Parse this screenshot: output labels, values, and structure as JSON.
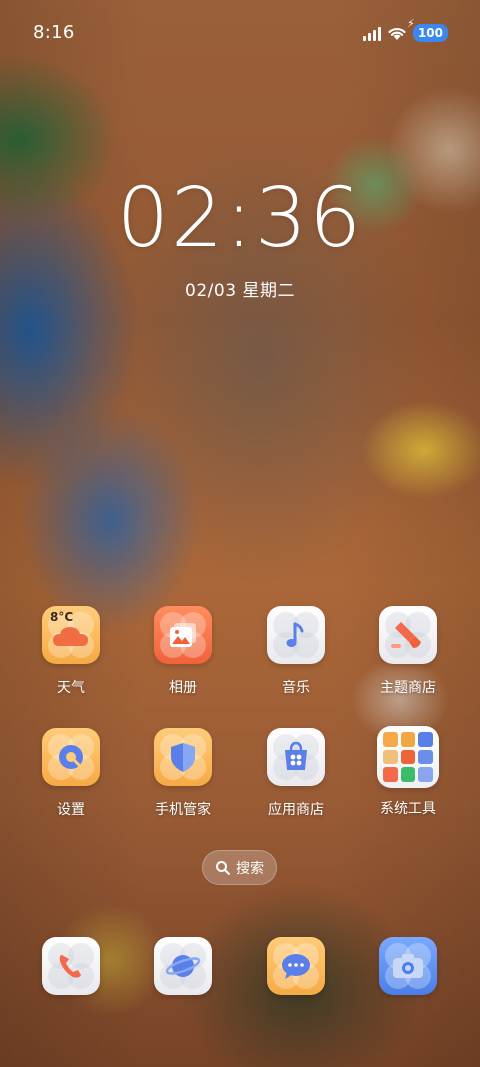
{
  "status_bar": {
    "time": "8:16",
    "battery": "100",
    "icons": [
      "signal-icon",
      "wifi-icon",
      "charging-bolt-icon",
      "battery-icon"
    ]
  },
  "lockscreen": {
    "clock": "02:36",
    "date": "02/03 星期二"
  },
  "apps": [
    {
      "label": "天气",
      "icon": "weather-icon",
      "temp": "8°C"
    },
    {
      "label": "相册",
      "icon": "gallery-icon"
    },
    {
      "label": "音乐",
      "icon": "music-icon"
    },
    {
      "label": "主题商店",
      "icon": "themes-icon"
    },
    {
      "label": "设置",
      "icon": "settings-icon"
    },
    {
      "label": "手机管家",
      "icon": "security-icon"
    },
    {
      "label": "应用商店",
      "icon": "app-store-icon"
    },
    {
      "label": "系统工具",
      "icon": "folder-icon"
    }
  ],
  "search": {
    "label": "搜索",
    "icon": "search-icon"
  },
  "dock": [
    {
      "icon": "phone-icon"
    },
    {
      "icon": "browser-icon"
    },
    {
      "icon": "messages-icon"
    },
    {
      "icon": "camera-icon"
    }
  ],
  "colors": {
    "accent_orange": "#f6aa43",
    "accent_red": "#f0623a",
    "accent_blue": "#4a7ee8",
    "battery_blue": "#3b87f0"
  }
}
